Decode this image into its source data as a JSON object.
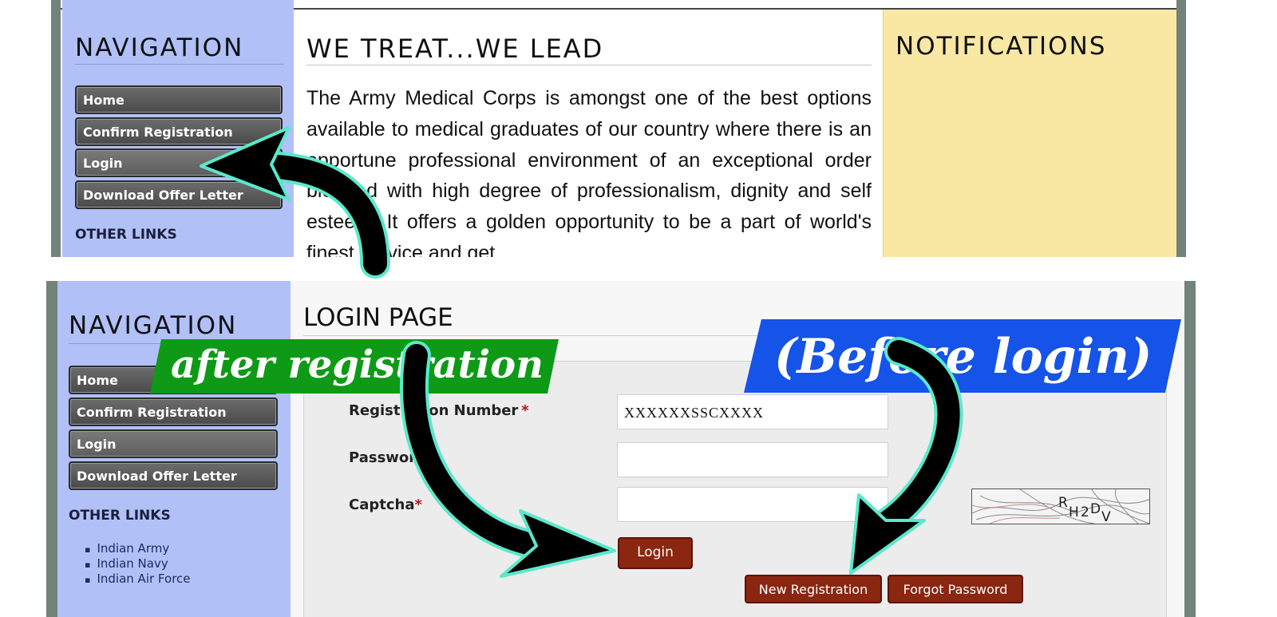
{
  "top_panel": {
    "navigation_title": "NAVIGATION",
    "nav_items": [
      {
        "label": "Home"
      },
      {
        "label": "Confirm Registration"
      },
      {
        "label": "Login"
      },
      {
        "label": "Download Offer Letter"
      }
    ],
    "other_links_title": "OTHER LINKS",
    "main_title": "WE TREAT...WE LEAD",
    "paragraph": "The Army Medical Corps is amongst one of the best options available to medical graduates of our country where there is an opportune professional environment of an exceptional order blended with high degree of professionalism, dignity and self esteem. It offers a golden opportunity to be a part of world's finest service and get",
    "notifications_title": "NOTIFICATIONS"
  },
  "bottom_panel": {
    "navigation_title": "NAVIGATION",
    "nav_items": [
      {
        "label": "Home"
      },
      {
        "label": "Confirm Registration"
      },
      {
        "label": "Login"
      },
      {
        "label": "Download Offer Letter"
      }
    ],
    "other_links_title": "OTHER LINKS",
    "other_links": [
      "Indian Army",
      "Indian Navy",
      "Indian Air Force"
    ],
    "login_title": "LOGIN PAGE",
    "form": {
      "registration_label": "Registration Number",
      "registration_value": "XXXXXXSSCXXXX",
      "password_label": "Password",
      "password_value": "",
      "captcha_label": "Captcha",
      "captcha_value": "",
      "required_mark": "*",
      "captcha_text": "RH2DV"
    },
    "buttons": {
      "login": "Login",
      "new_registration": "New Registration",
      "forgot_password": "Forgot Password"
    }
  },
  "annotations": {
    "after_registration": "after registration",
    "before_login": "(Before login)",
    "after_registration_color": "#0e9a17",
    "before_login_color": "#1653e8"
  }
}
